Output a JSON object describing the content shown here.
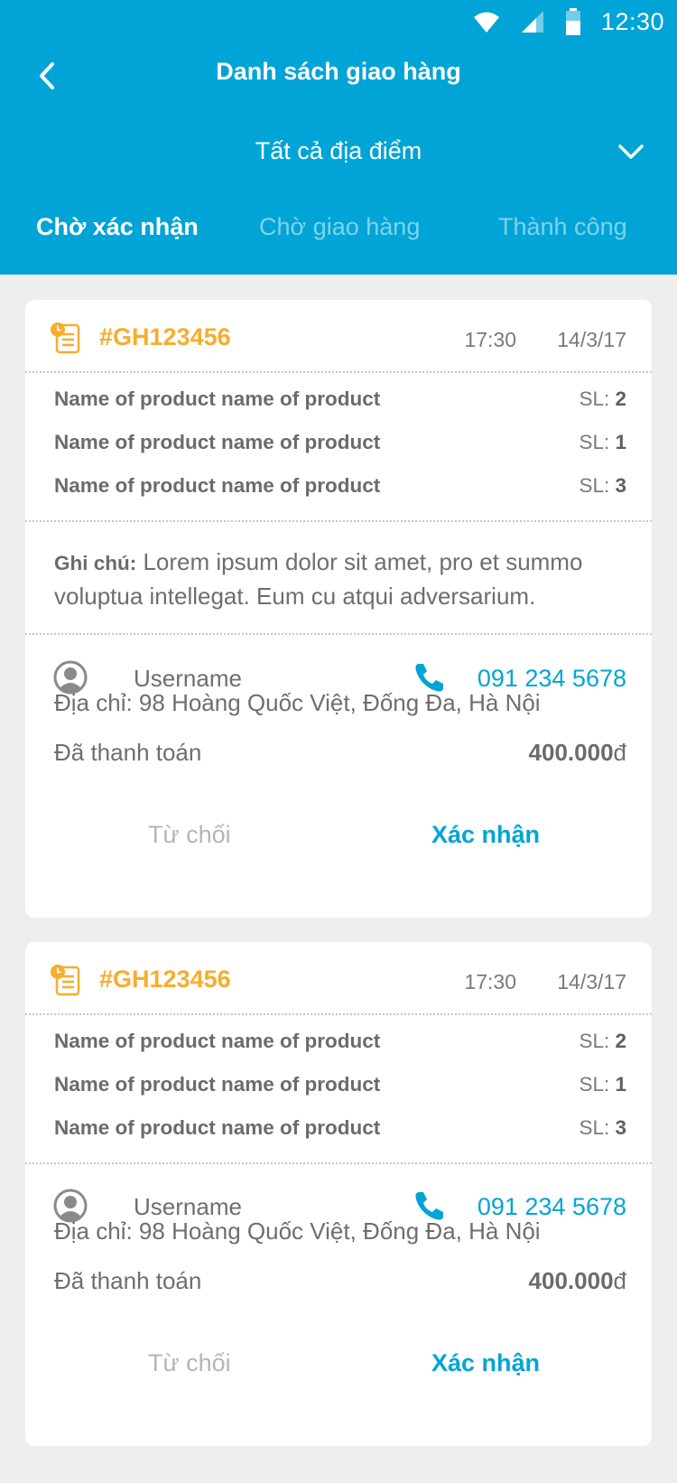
{
  "status_bar": {
    "time": "12:30",
    "icons": [
      "wifi-icon",
      "signal-icon",
      "battery-icon"
    ]
  },
  "header": {
    "title": "Danh sách giao hàng",
    "location_filter": "Tất cả địa điểm",
    "tabs": [
      {
        "label": "Chờ xác nhận",
        "active": true
      },
      {
        "label": "Chờ giao hàng",
        "active": false
      },
      {
        "label": "Thành công",
        "active": false
      }
    ]
  },
  "colors": {
    "primary": "#01a4d6",
    "accent": "#f7ad2d",
    "background": "#eeeeee"
  },
  "orders": [
    {
      "id": "#GH123456",
      "time": "17:30",
      "date": "14/3/17",
      "qty_prefix": "SL:",
      "products": [
        {
          "name": "Name of product name of product",
          "qty": "2"
        },
        {
          "name": "Name of product name of product",
          "qty": "1"
        },
        {
          "name": "Name of product name of product",
          "qty": "3"
        }
      ],
      "note_label": "Ghi chú:",
      "note_text": " Lorem ipsum dolor sit amet, pro et summo voluptua intellegat. Eum cu atqui adversarium.",
      "username": "Username",
      "phone": "091 234 5678",
      "address": "Địa chỉ: 98 Hoàng Quốc Việt, Đống Đa, Hà Nội",
      "paid_label": "Đã thanh toán",
      "amount": "400.000",
      "currency": "đ",
      "reject_label": "Từ chối",
      "confirm_label": "Xác nhận"
    },
    {
      "id": "#GH123456",
      "time": "17:30",
      "date": "14/3/17",
      "qty_prefix": "SL:",
      "products": [
        {
          "name": "Name of product name of product",
          "qty": "2"
        },
        {
          "name": "Name of product name of product",
          "qty": "1"
        },
        {
          "name": "Name of product name of product",
          "qty": "3"
        }
      ],
      "username": "Username",
      "phone": "091 234 5678",
      "address": "Địa chỉ: 98 Hoàng Quốc Việt, Đống Đa, Hà Nội",
      "paid_label": "Đã thanh toán",
      "amount": "400.000",
      "currency": "đ",
      "reject_label": "Từ chối",
      "confirm_label": "Xác nhận"
    }
  ]
}
